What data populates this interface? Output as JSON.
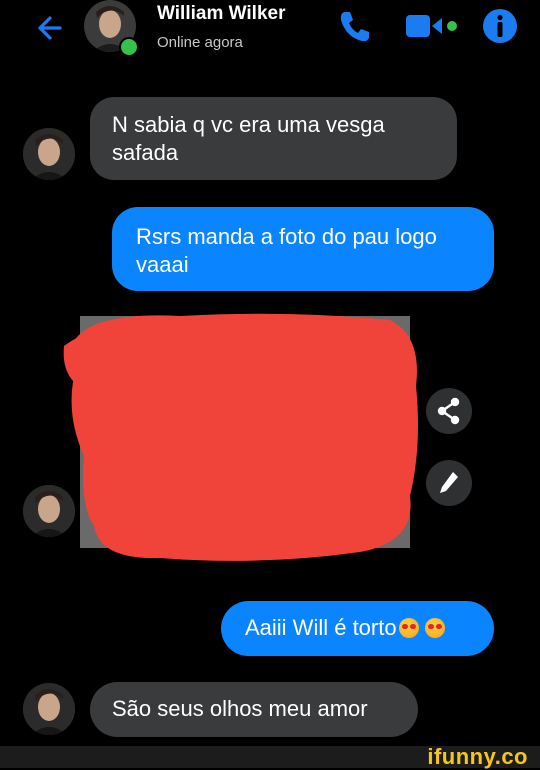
{
  "header": {
    "contact_name": "William Wilker",
    "status": "Online agora",
    "icons": {
      "back": "back-arrow-icon",
      "call": "phone-icon",
      "video": "video-camera-icon",
      "info": "info-icon"
    }
  },
  "messages": [
    {
      "direction": "incoming",
      "text_line1": "N sabia q vc era uma vesga",
      "text_line2": "safada"
    },
    {
      "direction": "outgoing",
      "text_line1": "Rsrs manda a foto do pau logo",
      "text_line2": "vaaai"
    },
    {
      "direction": "incoming",
      "type": "photo",
      "redacted": true
    },
    {
      "direction": "outgoing",
      "text": "Aaiii Will é torto",
      "emoji": [
        "heart-eyes",
        "heart-eyes"
      ]
    },
    {
      "direction": "incoming",
      "text": "São seus olhos meu amor"
    }
  ],
  "photo_actions": [
    "share-icon",
    "edit-pencil-icon"
  ],
  "watermark": "ifunny.co",
  "colors": {
    "background": "#000000",
    "incoming_bubble": "#3a3b3c",
    "outgoing_bubble": "#0b84ff",
    "accent": "#0b84ff",
    "online": "#35c24a",
    "redaction": "#f0443a",
    "watermark": "#f6c71a"
  }
}
